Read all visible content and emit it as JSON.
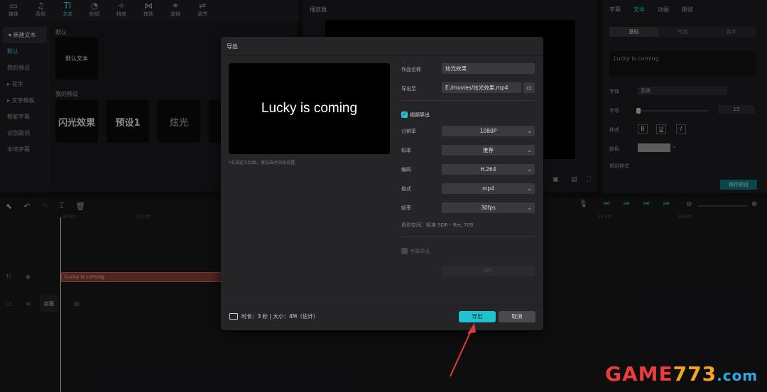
{
  "topbar": {
    "tools": [
      {
        "label": "媒体",
        "icon": "media-icon",
        "glyph": "▭"
      },
      {
        "label": "音频",
        "icon": "audio-icon",
        "glyph": "♫"
      },
      {
        "label": "文本",
        "icon": "text-icon",
        "glyph": "TI",
        "active": true
      },
      {
        "label": "贴纸",
        "icon": "sticker-icon",
        "glyph": "◔"
      },
      {
        "label": "特效",
        "icon": "effects-icon",
        "glyph": "✧"
      },
      {
        "label": "转场",
        "icon": "transition-icon",
        "glyph": "⋈"
      },
      {
        "label": "滤镜",
        "icon": "filter-icon",
        "glyph": "⚭"
      },
      {
        "label": "调节",
        "icon": "adjust-icon",
        "glyph": "⇌"
      }
    ]
  },
  "left_nav": {
    "new_text": "新建文本",
    "items": [
      "默认",
      "我的预设"
    ],
    "groups": [
      "花字",
      "文字模板"
    ],
    "more": [
      "智能字幕",
      "识别歌词",
      "本地字幕"
    ]
  },
  "presets": {
    "default_title": "默认",
    "default_tile": "默认文本",
    "mine_title": "我的预设",
    "tiles": [
      "闪光效果",
      "预设1",
      "炫光"
    ]
  },
  "player": {
    "title": "播放器"
  },
  "right_panel": {
    "tabs": [
      "字幕",
      "文本",
      "动画",
      "朗读"
    ],
    "subtabs": [
      "基础",
      "气泡",
      "花字"
    ],
    "text_value": "Lucky is coming",
    "font_label": "字体",
    "font_value": "系统",
    "size_label": "字号",
    "size_value": "15",
    "style_label": "样式",
    "style_buttons": [
      "B",
      "U",
      "I"
    ],
    "color_label": "颜色",
    "preset_label": "预设样式",
    "save_preset": "保存预设"
  },
  "timeline": {
    "clip_label": "Lucky is coming",
    "cover_label": "封面",
    "ruler": [
      "00:00",
      "10:00f",
      "10:00f",
      "10:00f"
    ]
  },
  "dialog": {
    "title": "导出",
    "preview_text": "Lucky is coming",
    "preview_note": "*未自定义封面，建议去时间线设置。",
    "name_label": "作品名称",
    "name_value": "炫光效果",
    "path_label": "导出至",
    "path_value": "E:/movies/炫光效果.mp4",
    "video_export_label": "视频导出",
    "resolution_label": "分辨率",
    "resolution_value": "1080P",
    "bitrate_label": "码率",
    "bitrate_value": "推荐",
    "codec_label": "编码",
    "codec_value": "H.264",
    "format_label": "格式",
    "format_value": "mp4",
    "fps_label": "帧率",
    "fps_value": "30fps",
    "colorspace": "色彩空间：标准 SDR - Rec.709",
    "subtitle_export_label": "字幕导出",
    "subtitle_format_value": "SRT",
    "footer_info": "时长：3 秒 | 大小：4M（估计）",
    "export_button": "导出",
    "cancel_button": "取消"
  },
  "watermark": {
    "main": "GAME",
    "num": "773",
    "tld": ".com"
  },
  "colors": {
    "accent": "#1fc3cf",
    "arrow": "#e03a3a"
  }
}
